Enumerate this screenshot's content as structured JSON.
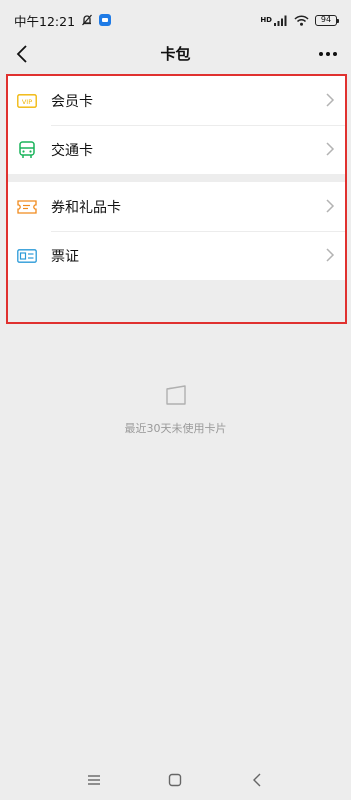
{
  "status_bar": {
    "time": "中午12:21",
    "battery": "94",
    "network": "HD"
  },
  "nav": {
    "title": "卡包"
  },
  "card_list": {
    "group1": [
      {
        "label": "会员卡",
        "icon": "vip-card-icon",
        "color": "#f0b400"
      },
      {
        "label": "交通卡",
        "icon": "bus-icon",
        "color": "#19b35a"
      }
    ],
    "group2": [
      {
        "label": "券和礼品卡",
        "icon": "coupon-icon",
        "color": "#f08a1c"
      },
      {
        "label": "票证",
        "icon": "ticket-id-icon",
        "color": "#2a9ad8"
      }
    ]
  },
  "empty_state": {
    "text": "最近30天未使用卡片"
  },
  "colors": {
    "highlight_border": "#e0312f",
    "background": "#ededed"
  }
}
